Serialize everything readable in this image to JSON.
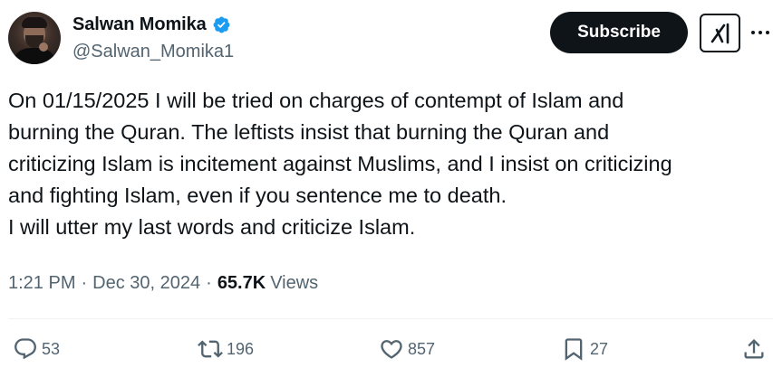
{
  "author": {
    "display_name": "Salwan Momika",
    "handle": "@Salwan_Momika1",
    "verified": true,
    "verified_color": "#1d9bf0"
  },
  "header_buttons": {
    "subscribe_label": "Subscribe",
    "grok_icon": "grok-icon",
    "more_icon": "more-options-icon"
  },
  "tweet": {
    "text": "On 01/15/2025 I will be tried on charges of contempt of Islam and\nburning the Quran. The leftists insist that burning the Quran and\ncriticizing Islam is incitement against Muslims, and I insist on criticizing\nand fighting Islam, even if you sentence me to death.\nI will utter my last words and criticize Islam."
  },
  "meta": {
    "time": "1:21 PM",
    "separator": "·",
    "date": "Dec 30, 2024",
    "views_count": "65.7K",
    "views_label": "Views"
  },
  "actions": {
    "replies": "53",
    "reposts": "196",
    "likes": "857",
    "bookmarks": "27"
  },
  "colors": {
    "text_primary": "#0f1419",
    "text_secondary": "#536471",
    "button_dark": "#0f1419",
    "divider": "#eff3f4"
  }
}
